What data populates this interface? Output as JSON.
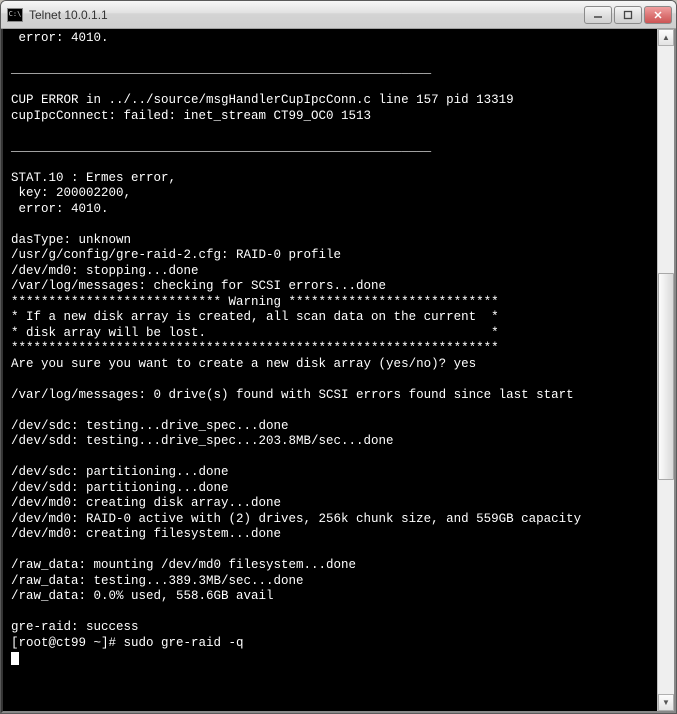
{
  "window": {
    "title": "Telnet 10.0.1.1"
  },
  "terminal": {
    "lines": [
      " error: 4010.",
      "",
      "________________________________________________________",
      "",
      "CUP ERROR in ../../source/msgHandlerCupIpcConn.c line 157 pid 13319",
      "cupIpcConnect: failed: inet_stream CT99_OC0 1513",
      "",
      "________________________________________________________",
      "",
      "STAT.10 : Ermes error,",
      " key: 200002200,",
      " error: 4010.",
      "",
      "dasType: unknown",
      "/usr/g/config/gre-raid-2.cfg: RAID-0 profile",
      "/dev/md0: stopping...done",
      "/var/log/messages: checking for SCSI errors...done",
      "**************************** Warning ****************************",
      "* If a new disk array is created, all scan data on the current  *",
      "* disk array will be lost.                                      *",
      "*****************************************************************",
      "Are you sure you want to create a new disk array (yes/no)? yes",
      "",
      "/var/log/messages: 0 drive(s) found with SCSI errors found since last start",
      "",
      "/dev/sdc: testing...drive_spec...done",
      "/dev/sdd: testing...drive_spec...203.8MB/sec...done",
      "",
      "/dev/sdc: partitioning...done",
      "/dev/sdd: partitioning...done",
      "/dev/md0: creating disk array...done",
      "/dev/md0: RAID-0 active with (2) drives, 256k chunk size, and 559GB capacity",
      "/dev/md0: creating filesystem...done",
      "",
      "/raw_data: mounting /dev/md0 filesystem...done",
      "/raw_data: testing...389.3MB/sec...done",
      "/raw_data: 0.0% used, 558.6GB avail",
      "",
      "gre-raid: success"
    ],
    "prompt": "[root@ct99 ~]# ",
    "command": "sudo gre-raid -q"
  }
}
